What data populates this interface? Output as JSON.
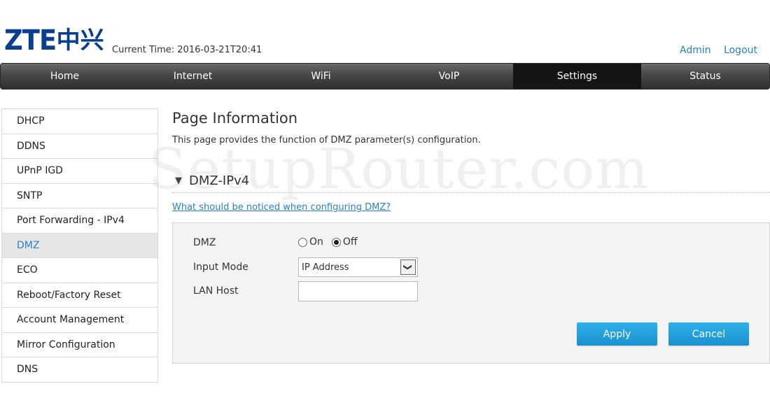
{
  "header": {
    "logo_text": "ZTE",
    "logo_cn": "中兴",
    "current_time": "Current Time: 2016-03-21T20:41",
    "admin_link": "Admin",
    "logout_link": "Logout"
  },
  "nav": {
    "items": [
      "Home",
      "Internet",
      "WiFi",
      "VoIP",
      "Settings",
      "Status"
    ],
    "active": "Settings"
  },
  "sidebar": {
    "items": [
      "DHCP",
      "DDNS",
      "UPnP IGD",
      "SNTP",
      "Port Forwarding - IPv4",
      "DMZ",
      "ECO",
      "Reboot/Factory Reset",
      "Account Management",
      "Mirror Configuration",
      "DNS"
    ],
    "active": "DMZ"
  },
  "main": {
    "page_title": "Page Information",
    "page_desc": "This page provides the function of DMZ parameter(s) configuration.",
    "watermark": "SetupRouter.com",
    "section_title": "DMZ-IPv4",
    "help_link": "What should be noticed when configuring DMZ?",
    "form": {
      "dmz_label": "DMZ",
      "dmz_on_label": "On",
      "dmz_off_label": "Off",
      "dmz_value": "Off",
      "input_mode_label": "Input Mode",
      "input_mode_value": "IP Address",
      "lan_host_label": "LAN Host",
      "lan_host_value": ""
    },
    "buttons": {
      "apply": "Apply",
      "cancel": "Cancel"
    }
  },
  "colors": {
    "accent": "#2a7fc6",
    "logo": "#0a3e8f",
    "button": "#1a91cf"
  }
}
